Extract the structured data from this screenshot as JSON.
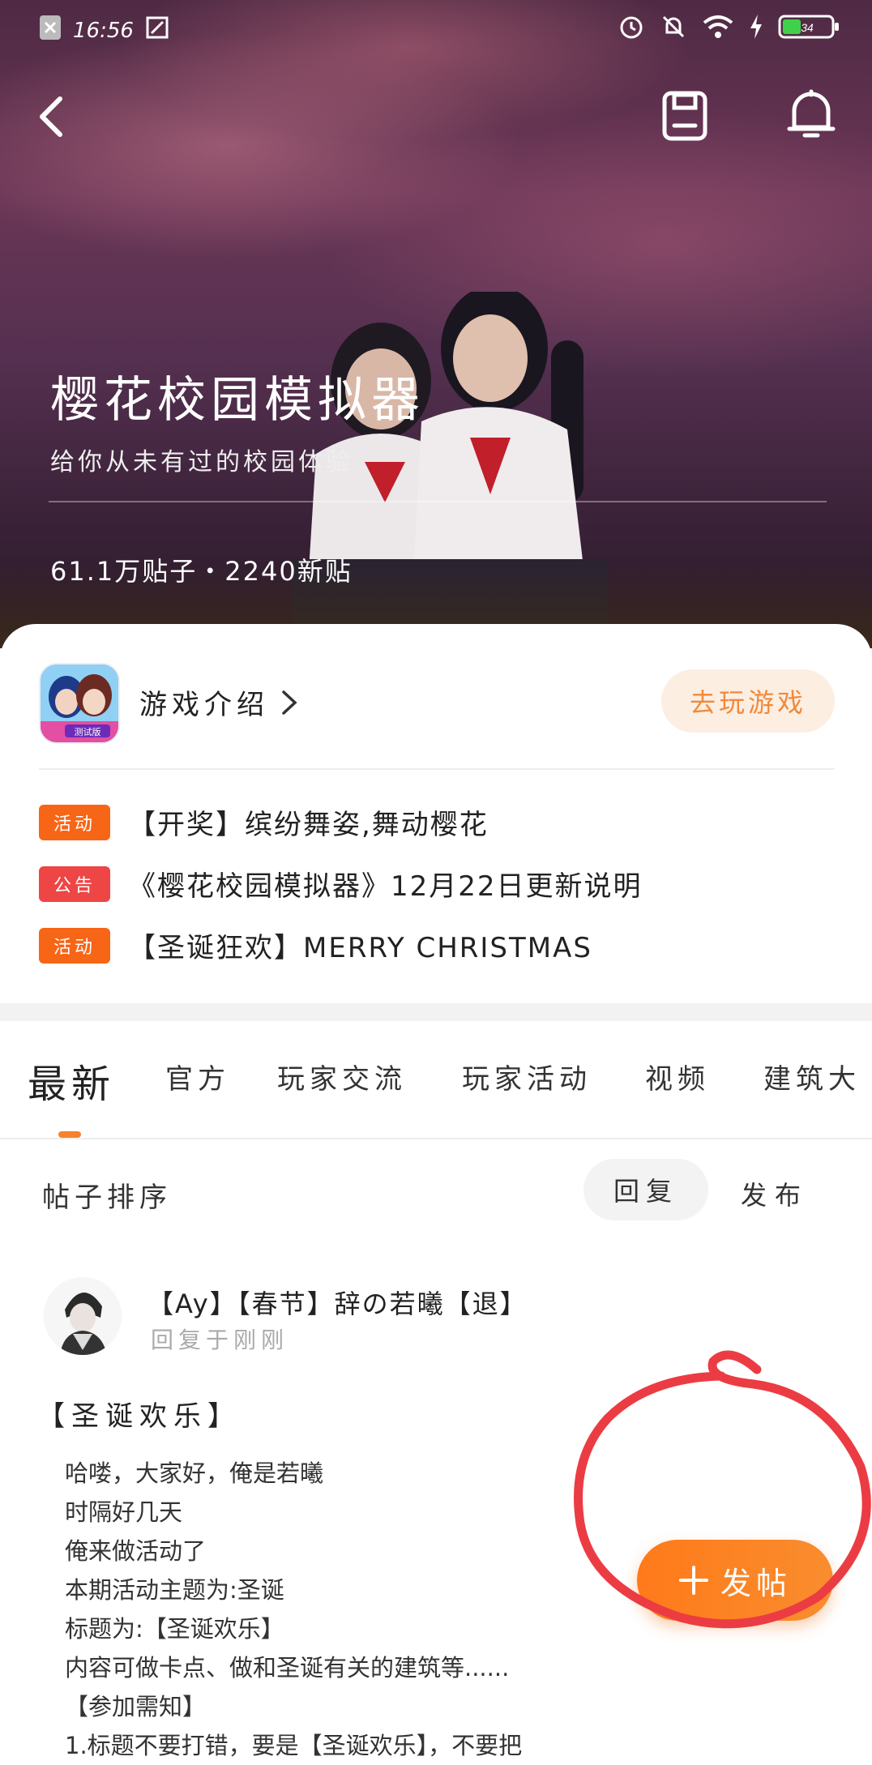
{
  "status_bar": {
    "time": "16:56",
    "battery": "34"
  },
  "header": {
    "title": "樱花校园模拟器",
    "subtitle": "给你从未有过的校园体验",
    "stats": "61.1万贴子・2240新贴"
  },
  "game_card": {
    "intro_label": "游戏介绍",
    "play_button": "去玩游戏",
    "icon_badge": "测试版"
  },
  "notices": [
    {
      "tag": "活动",
      "tag_color": "#f76516",
      "text": "【开奖】缤纷舞姿,舞动樱花"
    },
    {
      "tag": "公告",
      "tag_color": "#ee4545",
      "text": "《樱花校园模拟器》12月22日更新说明"
    },
    {
      "tag": "活动",
      "tag_color": "#f76516",
      "text": "【圣诞狂欢】MERRY CHRISTMAS"
    }
  ],
  "tabs": [
    "最新",
    "官方",
    "玩家交流",
    "玩家活动",
    "视频",
    "建筑大"
  ],
  "sort": {
    "label": "帖子排序",
    "reply": "回复",
    "publish": "发布"
  },
  "post": {
    "author": "【Ay】【春节】辞の若曦【退】",
    "time": "回复于刚刚",
    "title": "【圣诞欢乐】",
    "lines": [
      "哈喽，大家好，俺是若曦",
      "时隔好几天",
      "俺来做活动了",
      "本期活动主题为:圣诞",
      "标题为:【圣诞欢乐】",
      "内容可做卡点、做和圣诞有关的建筑等......",
      "【参加需知】",
      "1.标题不要打错，要是【圣诞欢乐】，不要把"
    ]
  },
  "fab": {
    "label": "发帖"
  },
  "colors": {
    "accent": "#f7822a",
    "hero_bg": "#553050"
  }
}
